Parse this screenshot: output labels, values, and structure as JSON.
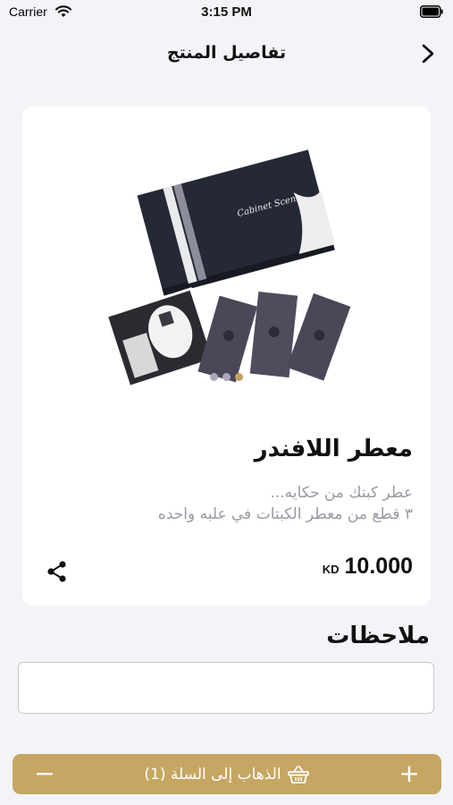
{
  "status_bar": {
    "carrier": "Carrier",
    "time": "3:15 PM"
  },
  "nav": {
    "title": "تفاصيل المنتج",
    "back_icon": "chevron-right-icon"
  },
  "product": {
    "title": "معطر اللافندر",
    "description_line1": "عطر كبتك من حكايه...",
    "description_line2": "٣ قطع من معطر الكبتات في علبه واحده",
    "price": "10.000",
    "currency": "KD",
    "image_pages": 3,
    "active_image_page": 3,
    "box_brand_text": "Cabinet Scent"
  },
  "notes": {
    "label": "ملاحظات",
    "value": "",
    "placeholder": ""
  },
  "cart": {
    "label": "الذهاب إلى السلة (1)",
    "minus": "−",
    "plus": "+"
  },
  "colors": {
    "accent": "#c6a663",
    "background": "#f3f4f8",
    "description": "#9a9aa6",
    "pager_inactive": "#a9a8bc"
  }
}
